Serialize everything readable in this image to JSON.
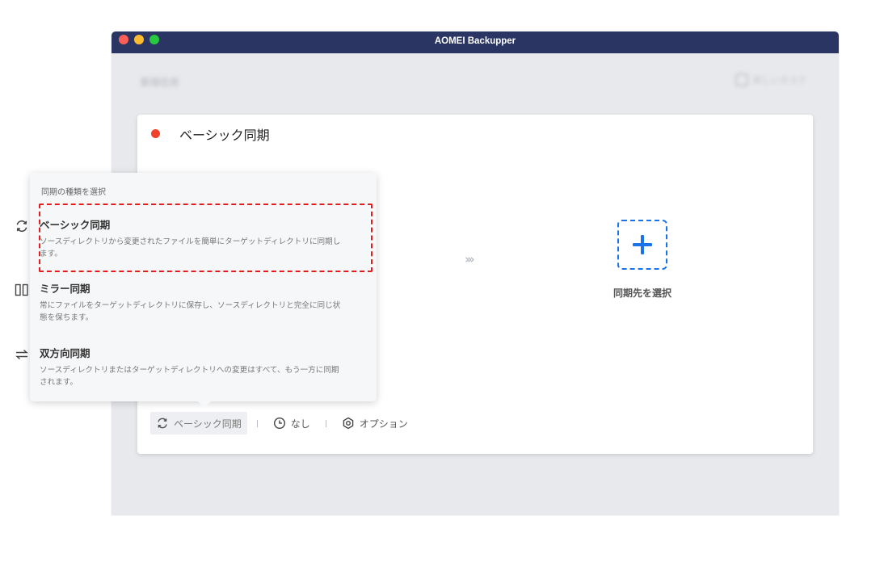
{
  "window": {
    "title": "AOMEI Backupper",
    "blurred_left": "新规任务",
    "blurred_right": "新しいタスク"
  },
  "task": {
    "title": "ベーシック同期",
    "destination_label": "同期先を選択"
  },
  "toolbar": {
    "sync_mode_label": "ベーシック同期",
    "schedule_label": "なし",
    "options_label": "オプション"
  },
  "popover": {
    "header": "同期の種類を選択",
    "options": [
      {
        "title": "ベーシック同期",
        "desc": "ソースディレクトリから変更されたファイルを簡単にターゲットディレクトリに同期します。",
        "icon": "sync-icon",
        "selected": true
      },
      {
        "title": "ミラー同期",
        "desc": "常にファイルをターゲットディレクトリに保存し、ソースディレクトリと完全に同じ状態を保ちます。",
        "icon": "mirror-icon"
      },
      {
        "title": "双方向同期",
        "desc": "ソースディレクトリまたはターゲットディレクトリへの変更はすべて、もう一方に同期されます。",
        "icon": "two-way-arrows-icon"
      }
    ]
  },
  "colors": {
    "titlebar": "#2a3563",
    "accent": "#1a73e8",
    "status_dot": "#f0422a",
    "highlight": "#e11d1d"
  }
}
